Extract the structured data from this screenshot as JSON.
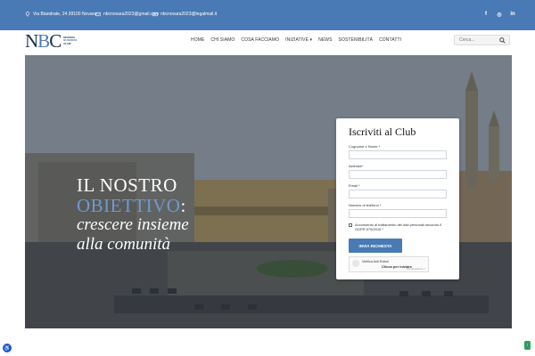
{
  "topbar": {
    "address": "Via Biandrate, 24 28100 Novara",
    "email1": "nbcnovara2023@gmail.com",
    "email2": "nbcnovara2023@legalmail.it",
    "social": [
      "facebook-icon",
      "instagram-icon",
      "linkedin-icon"
    ]
  },
  "logo": {
    "letters_n": "N",
    "letters_b": "B",
    "letters_c": "C",
    "sub1": "NOVARA",
    "sub2": "BUSINESS",
    "sub3": "CLUB"
  },
  "menu": {
    "items": [
      "HOME",
      "CHI SIAMO",
      "COSA FACCIAMO",
      "INIZIATIVE ▾",
      "NEWS",
      "SOSTENIBILITÀ",
      "CONTATTI"
    ]
  },
  "search": {
    "placeholder": "Cerca..."
  },
  "hero": {
    "line1": "IL NOSTRO",
    "line2": "OBIETTIVO",
    "line2_colon": ":",
    "line3": "crescere insieme",
    "line4": "alla comunità"
  },
  "form": {
    "title": "Iscriviti al Club",
    "fields": [
      {
        "label": "Cognome e Nome *"
      },
      {
        "label": "Azienda*"
      },
      {
        "label": "Email *"
      },
      {
        "label": "Numero di telefono *"
      }
    ],
    "consent": "Acconsento al trattamento dei dati personali secondo il GDPR 679/2016 *",
    "submit": "INVIA RICHIESTA",
    "captcha": {
      "line1": "Verifica Anti-Robot",
      "line2": "Clicca per iniziare",
      "footer": "FriendlyCaptcha ↗"
    }
  },
  "colors": {
    "accent": "#4a7ab5",
    "dark": "#1c2b4a"
  }
}
